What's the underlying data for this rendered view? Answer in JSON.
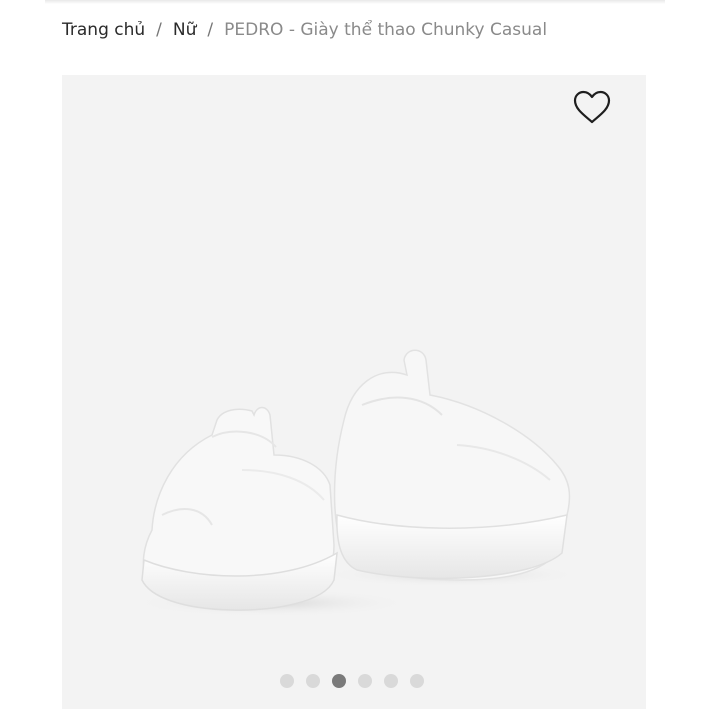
{
  "breadcrumb": {
    "home": "Trang chủ",
    "category": "Nữ",
    "current": "PEDRO - Giày thể thao Chunky Casual",
    "separator": "/"
  },
  "gallery": {
    "wishlist_icon": "heart-outline-icon",
    "image_subject": "white chunky casual sneakers (pair, rear view)",
    "slide_count": 6,
    "active_slide": 3
  },
  "colors": {
    "gallery_background": "#f3f3f3",
    "dot_inactive": "#d9d9d9",
    "dot_active": "#7a7a7a"
  }
}
